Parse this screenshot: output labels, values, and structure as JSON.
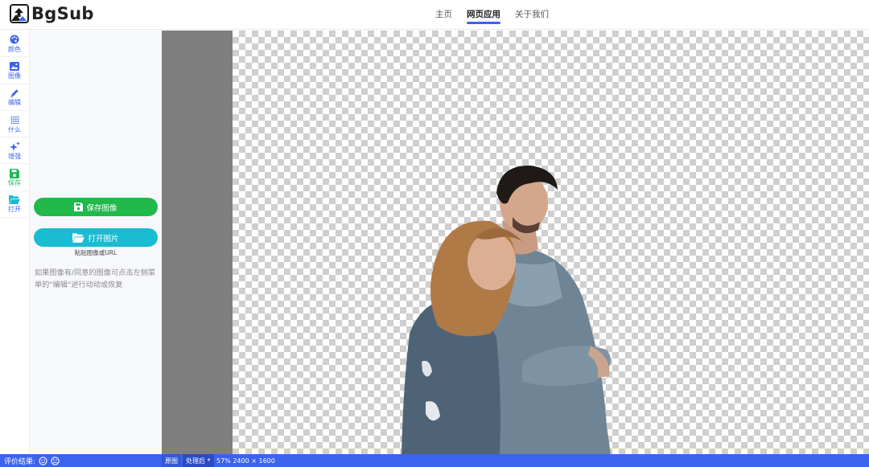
{
  "app": {
    "name": "BgSub"
  },
  "nav": {
    "items": [
      "主页",
      "网页应用",
      "关于我们"
    ],
    "active_index": 1
  },
  "rail": {
    "items": [
      {
        "label": "颜色",
        "icon": "palette-icon"
      },
      {
        "label": "图像",
        "icon": "image-icon"
      },
      {
        "label": "编辑",
        "icon": "pencil-icon"
      },
      {
        "label": "什么",
        "icon": "grid-dots-icon"
      },
      {
        "label": "增强",
        "icon": "sparkle-icon"
      },
      {
        "label": "保存",
        "icon": "save-icon"
      },
      {
        "label": "打开",
        "icon": "folder-open-icon"
      }
    ]
  },
  "panel": {
    "save_label": "保存图像",
    "open_label": "打开图片",
    "paste_hint": "粘贴图像或URL",
    "info": "如果图像有/同意的图像可点击左侧菜单的\"编辑\"进行动动或恢复"
  },
  "status": {
    "rating_label": "评价结果:",
    "tab_original": "原图",
    "tab_processed": "处理后 *",
    "zoom_info": "57% 2400 × 1600"
  },
  "colors": {
    "accent": "#3b63f0",
    "green": "#20b94a",
    "cyan": "#19bcd0",
    "checker": "#cfcfcf"
  }
}
